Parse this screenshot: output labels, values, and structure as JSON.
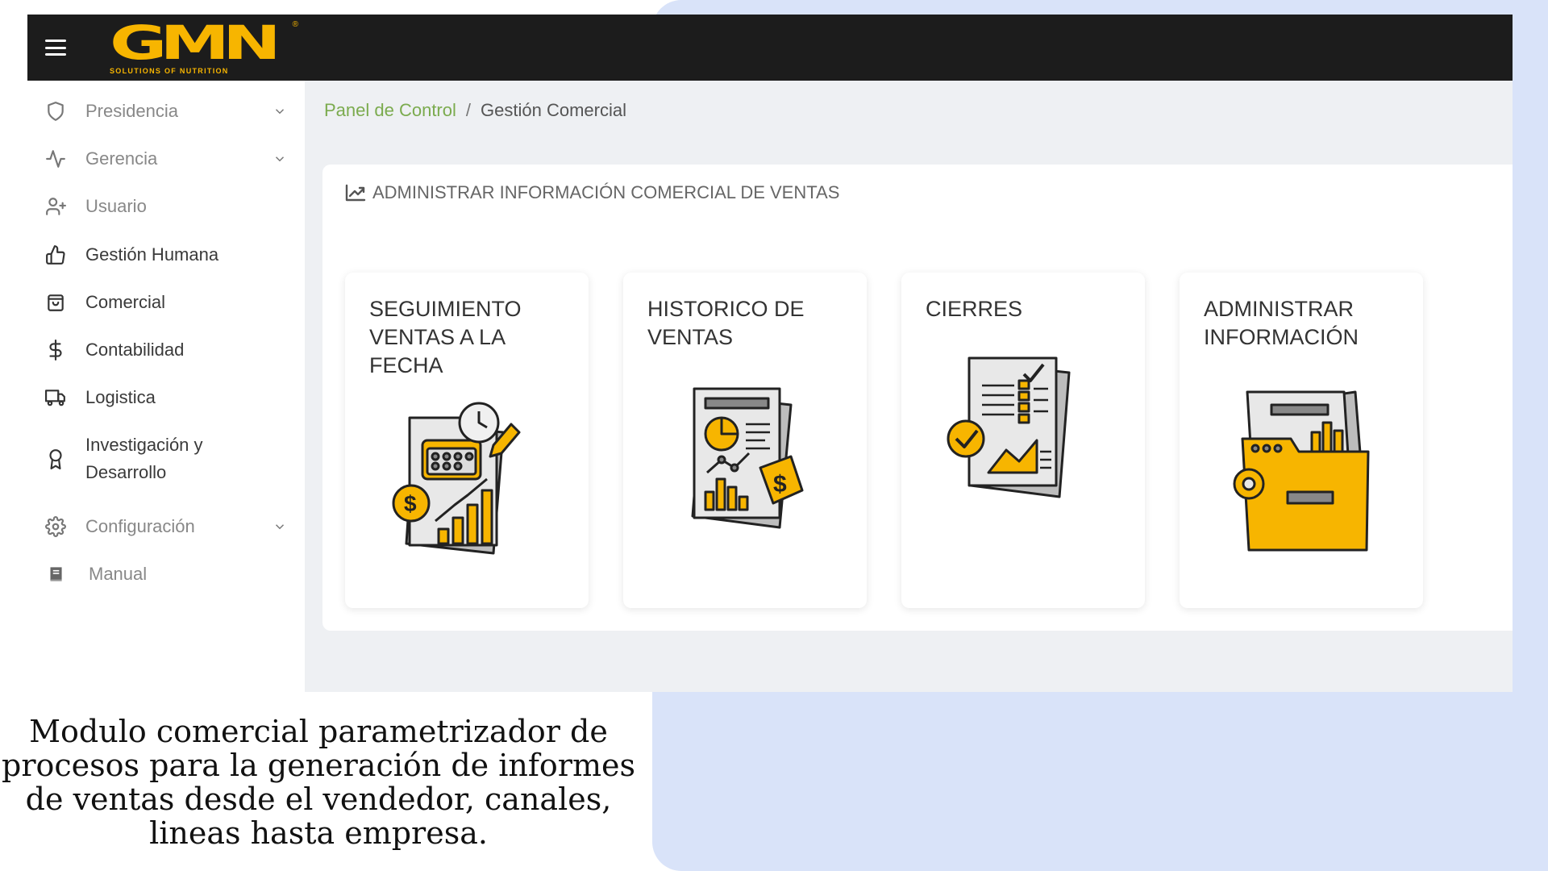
{
  "topbar": {
    "menu_icon": "hamburger-icon",
    "logo": {
      "text": "GMN",
      "subtitle": "SOLUTIONS OF NUTRITION",
      "reg": "®"
    }
  },
  "sidebar": {
    "items": [
      {
        "label": "Presidencia",
        "icon": "shield-icon",
        "expandable": true,
        "muted": true
      },
      {
        "label": "Gerencia",
        "icon": "activity-icon",
        "expandable": true,
        "muted": true
      },
      {
        "label": "Usuario",
        "icon": "user-plus-icon",
        "expandable": false,
        "muted": true
      },
      {
        "label": "Gestión Humana",
        "icon": "thumbs-up-icon",
        "expandable": false,
        "muted": false
      },
      {
        "label": "Comercial",
        "icon": "shopping-bag-icon",
        "expandable": false,
        "muted": false
      },
      {
        "label": "Contabilidad",
        "icon": "dollar-icon",
        "expandable": false,
        "muted": false
      },
      {
        "label": "Logistica",
        "icon": "truck-icon",
        "expandable": false,
        "muted": false
      },
      {
        "label": "Investigación y Desarrollo",
        "icon": "award-icon",
        "expandable": false,
        "muted": false
      },
      {
        "label": "Configuración",
        "icon": "gear-icon",
        "expandable": true,
        "muted": true
      },
      {
        "label": "Manual",
        "icon": "book-icon",
        "expandable": false,
        "muted": true
      }
    ]
  },
  "breadcrumb": {
    "root": "Panel de Control",
    "separator": "/",
    "current": "Gestión Comercial"
  },
  "panel": {
    "title": "ADMINISTRAR INFORMACIÓN COMERCIAL DE VENTAS",
    "cards": [
      {
        "title": "SEGUIMIENTO VENTAS A LA FECHA",
        "icon": "sales-tracking-icon"
      },
      {
        "title": "HISTORICO DE VENTAS",
        "icon": "sales-history-icon"
      },
      {
        "title": "CIERRES",
        "icon": "closures-icon"
      },
      {
        "title": "ADMINISTRAR INFORMACIÓN",
        "icon": "admin-folder-icon"
      }
    ]
  },
  "caption": "Modulo comercial parametrizador de procesos para la generación de informes de ventas desde el vendedor, canales, lineas hasta empresa.",
  "colors": {
    "accent": "#f7b500",
    "topbar": "#1c1c1c",
    "breadcrumb_link": "#7bab4e",
    "background_blob": "#d9e3f9",
    "content_bg": "#eef0f3"
  }
}
